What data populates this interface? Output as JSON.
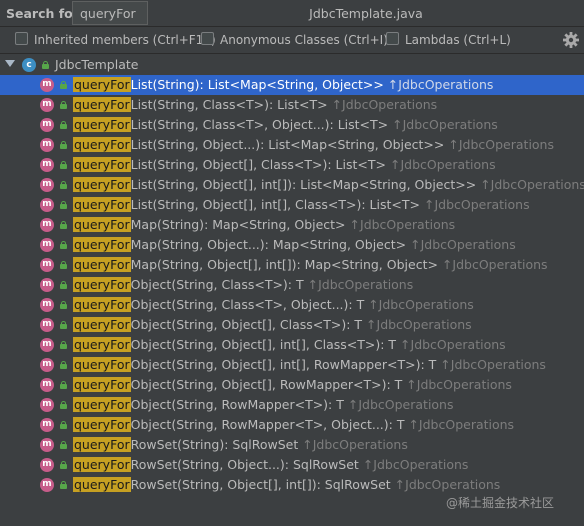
{
  "header": {
    "search_label": "Search for:",
    "search_value": "queryFor",
    "file_title": "JdbcTemplate.java"
  },
  "filters": {
    "inherited_label": "Inherited members (Ctrl+F12)",
    "anonymous_label": "Anonymous Classes (Ctrl+I)",
    "lambdas_label": "Lambdas (Ctrl+L)"
  },
  "tree": {
    "root_label": "JdbcTemplate",
    "highlight": "queryFor",
    "items": [
      {
        "rest": "List(String): List<Map<String, Object>>",
        "inherited": "↑JdbcOperations"
      },
      {
        "rest": "List(String, Class<T>): List<T>",
        "inherited": "↑JdbcOperations"
      },
      {
        "rest": "List(String, Class<T>, Object...): List<T>",
        "inherited": "↑JdbcOperations"
      },
      {
        "rest": "List(String, Object...): List<Map<String, Object>>",
        "inherited": "↑JdbcOperations"
      },
      {
        "rest": "List(String, Object[], Class<T>): List<T>",
        "inherited": "↑JdbcOperations"
      },
      {
        "rest": "List(String, Object[], int[]): List<Map<String, Object>>",
        "inherited": "↑JdbcOperations"
      },
      {
        "rest": "List(String, Object[], int[], Class<T>): List<T>",
        "inherited": "↑JdbcOperations"
      },
      {
        "rest": "Map(String): Map<String, Object>",
        "inherited": "↑JdbcOperations"
      },
      {
        "rest": "Map(String, Object...): Map<String, Object>",
        "inherited": "↑JdbcOperations"
      },
      {
        "rest": "Map(String, Object[], int[]): Map<String, Object>",
        "inherited": "↑JdbcOperations"
      },
      {
        "rest": "Object(String, Class<T>): T",
        "inherited": "↑JdbcOperations"
      },
      {
        "rest": "Object(String, Class<T>, Object...): T",
        "inherited": "↑JdbcOperations"
      },
      {
        "rest": "Object(String, Object[], Class<T>): T",
        "inherited": "↑JdbcOperations"
      },
      {
        "rest": "Object(String, Object[], int[], Class<T>): T",
        "inherited": "↑JdbcOperations"
      },
      {
        "rest": "Object(String, Object[], int[], RowMapper<T>): T",
        "inherited": "↑JdbcOperations"
      },
      {
        "rest": "Object(String, Object[], RowMapper<T>): T",
        "inherited": "↑JdbcOperations"
      },
      {
        "rest": "Object(String, RowMapper<T>): T",
        "inherited": "↑JdbcOperations"
      },
      {
        "rest": "Object(String, RowMapper<T>, Object...): T",
        "inherited": "↑JdbcOperations"
      },
      {
        "rest": "RowSet(String): SqlRowSet",
        "inherited": "↑JdbcOperations"
      },
      {
        "rest": "RowSet(String, Object...): SqlRowSet",
        "inherited": "↑JdbcOperations"
      },
      {
        "rest": "RowSet(String, Object[], int[]): SqlRowSet",
        "inherited": "↑JdbcOperations"
      }
    ]
  },
  "watermark": "@稀土掘金技术社区",
  "icons": {
    "class": "class-c-icon",
    "method": "method-m-icon",
    "public": "public-lock-icon",
    "expand": "expand-arrow-icon",
    "settings": "gear-icon"
  },
  "colors": {
    "background": "#3c3f41",
    "selection": "#2f65ca",
    "match_highlight": "#c6a022",
    "method_icon": "#c75d8a",
    "class_icon": "#3d8fc4",
    "inherited_text": "#7d7d7d"
  }
}
